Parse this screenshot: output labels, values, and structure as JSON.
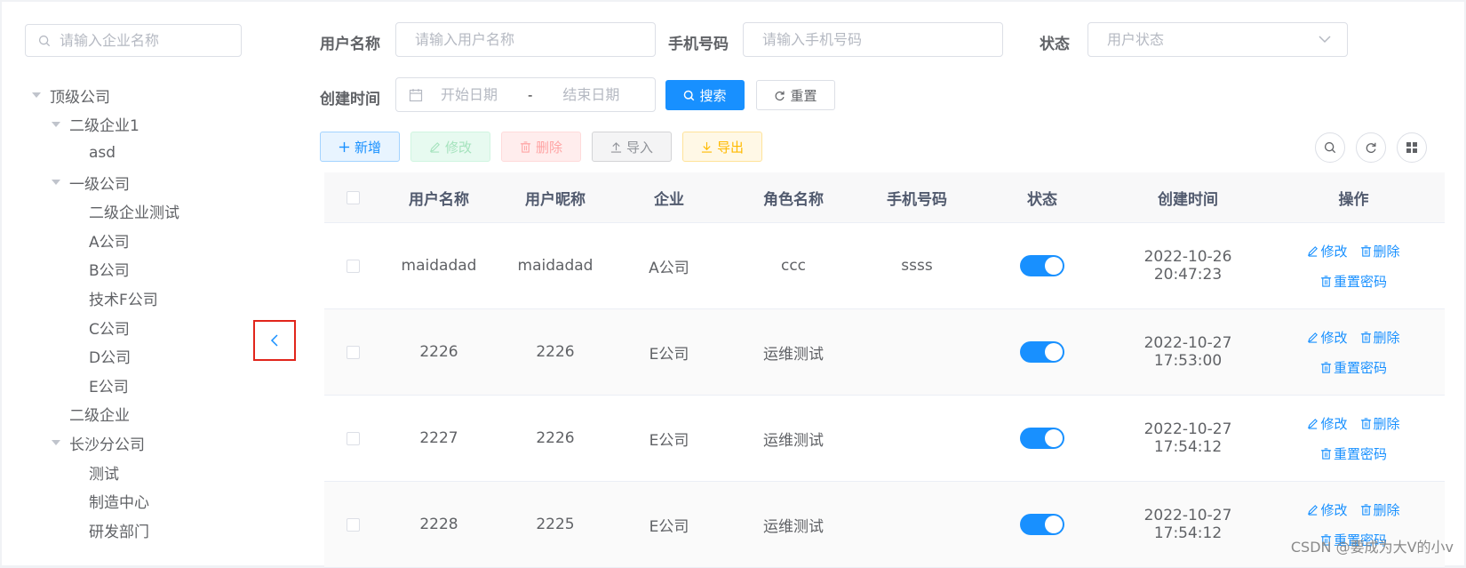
{
  "tree": {
    "search_placeholder": "请输入企业名称",
    "nodes": [
      {
        "label": "顶级公司",
        "level": 0,
        "expanded": true
      },
      {
        "label": "二级企业1",
        "level": 1,
        "expanded": true
      },
      {
        "label": "asd",
        "level": 2
      },
      {
        "label": "一级公司",
        "level": 1,
        "expanded": true
      },
      {
        "label": "二级企业测试",
        "level": 2
      },
      {
        "label": "A公司",
        "level": 2
      },
      {
        "label": "B公司",
        "level": 2
      },
      {
        "label": "技术F公司",
        "level": 2
      },
      {
        "label": "C公司",
        "level": 2
      },
      {
        "label": "D公司",
        "level": 2
      },
      {
        "label": "E公司",
        "level": 2
      },
      {
        "label": "二级企业",
        "level": 1
      },
      {
        "label": "长沙分公司",
        "level": 1,
        "expanded": true
      },
      {
        "label": "测试",
        "level": 2
      },
      {
        "label": "制造中心",
        "level": 2
      },
      {
        "label": "研发部门",
        "level": 2
      }
    ]
  },
  "form": {
    "username_label": "用户名称",
    "username_placeholder": "请输入用户名称",
    "phone_label": "手机号码",
    "phone_placeholder": "请输入手机号码",
    "status_label": "状态",
    "status_placeholder": "用户状态",
    "created_label": "创建时间",
    "start_placeholder": "开始日期",
    "date_separator": "-",
    "end_placeholder": "结束日期",
    "search_button": "搜索",
    "reset_button": "重置"
  },
  "toolbar": {
    "add": "新增",
    "edit": "修改",
    "delete": "删除",
    "import": "导入",
    "export": "导出"
  },
  "table": {
    "columns": [
      "用户名称",
      "用户昵称",
      "企业",
      "角色名称",
      "手机号码",
      "状态",
      "创建时间",
      "操作"
    ],
    "rows": [
      {
        "username": "maidadad",
        "nickname": "maidadad",
        "company": "A公司",
        "role": "ccc",
        "phone": "ssss",
        "enabled": true,
        "created": "2022-10-26 20:47:23"
      },
      {
        "username": "2226",
        "nickname": "2226",
        "company": "E公司",
        "role": "运维测试",
        "phone": "",
        "enabled": true,
        "created": "2022-10-27 17:53:00"
      },
      {
        "username": "2227",
        "nickname": "2226",
        "company": "E公司",
        "role": "运维测试",
        "phone": "",
        "enabled": true,
        "created": "2022-10-27 17:54:12"
      },
      {
        "username": "2228",
        "nickname": "2225",
        "company": "E公司",
        "role": "运维测试",
        "phone": "",
        "enabled": true,
        "created": "2022-10-27 17:54:12"
      }
    ],
    "actions": {
      "edit": "修改",
      "delete": "删除",
      "reset_password": "重置密码"
    }
  },
  "watermark": "CSDN @要成为大V的小v",
  "colors": {
    "primary": "#1890ff",
    "highlight_border": "#e1251b"
  }
}
